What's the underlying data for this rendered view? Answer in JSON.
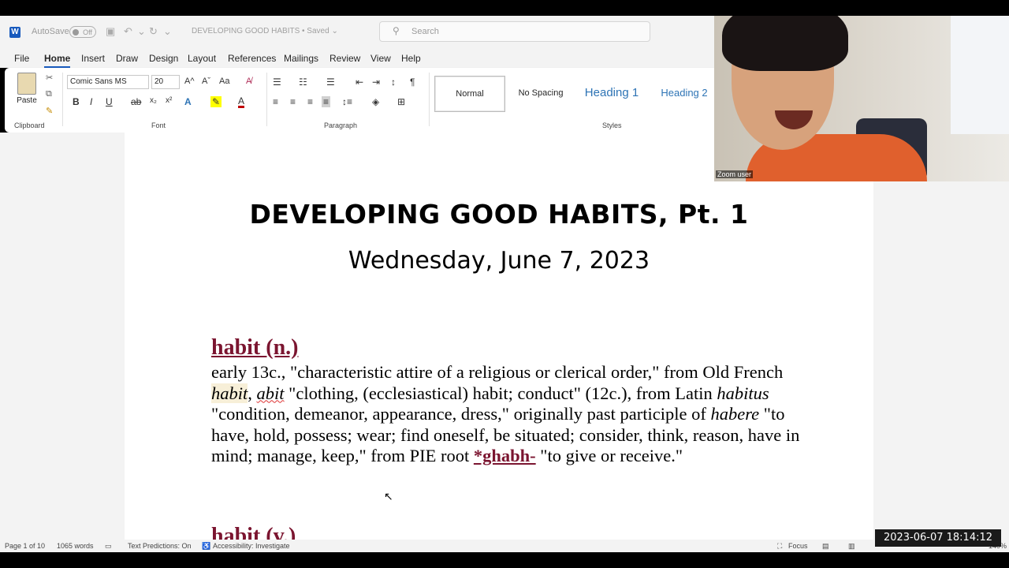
{
  "titlebar": {
    "app_icon": "W",
    "autosave_label": "AutoSave",
    "autosave_state": "Off",
    "document_title": "DEVELOPING GOOD HABITS • Saved ⌄"
  },
  "search": {
    "placeholder": "Search"
  },
  "menu": {
    "tabs": [
      "File",
      "Home",
      "Insert",
      "Draw",
      "Design",
      "Layout",
      "References",
      "Mailings",
      "Review",
      "View",
      "Help"
    ],
    "active_tab": "Home"
  },
  "ribbon": {
    "clipboard": {
      "paste_label": "Paste",
      "group_label": "Clipboard"
    },
    "font": {
      "family": "Comic Sans MS",
      "size": "20",
      "group_label": "Font"
    },
    "paragraph": {
      "group_label": "Paragraph"
    },
    "styles": {
      "group_label": "Styles",
      "items": [
        "Normal",
        "No Spacing",
        "Heading 1",
        "Heading 2"
      ]
    }
  },
  "document": {
    "title": "DEVELOPING GOOD HABITS, Pt. 1",
    "date": "Wednesday, June 7, 2023",
    "entry1": {
      "head": "habit (n.)",
      "t1": "early 13c., \"characteristic attire of a religious or clerical order,\" from Old French ",
      "t2": "habit",
      "t3": ", ",
      "t4": "abit",
      "t5": " \"clothing, (ecclesiastical) habit; conduct\" (12c.), from Latin ",
      "t6": "habitus",
      "t7": " \"condition, demeanor, appearance, dress,\" originally past participle of ",
      "t8": "habere",
      "t9": " \"to have, hold, possess; wear; find oneself, be situated; consider, think, reason, have in mind; manage, keep,\" from PIE root ",
      "t10": "*ghabh-",
      "t11": " \"to give or receive.\""
    },
    "entry2_head": "habit (v.)"
  },
  "statusbar": {
    "page": "Page 1 of 10",
    "words": "1065 words",
    "text_predictions": "Text Predictions: On",
    "accessibility": "Accessibility: Investigate",
    "focus": "Focus",
    "zoom": "140%"
  },
  "video": {
    "participant": "Zoom user"
  },
  "overlay_timestamp": "2023-06-07  18:14:12",
  "colors": {
    "word_blue": "#185abd",
    "entry_maroon": "#7b1530",
    "heading_blue": "#2e74b5"
  }
}
